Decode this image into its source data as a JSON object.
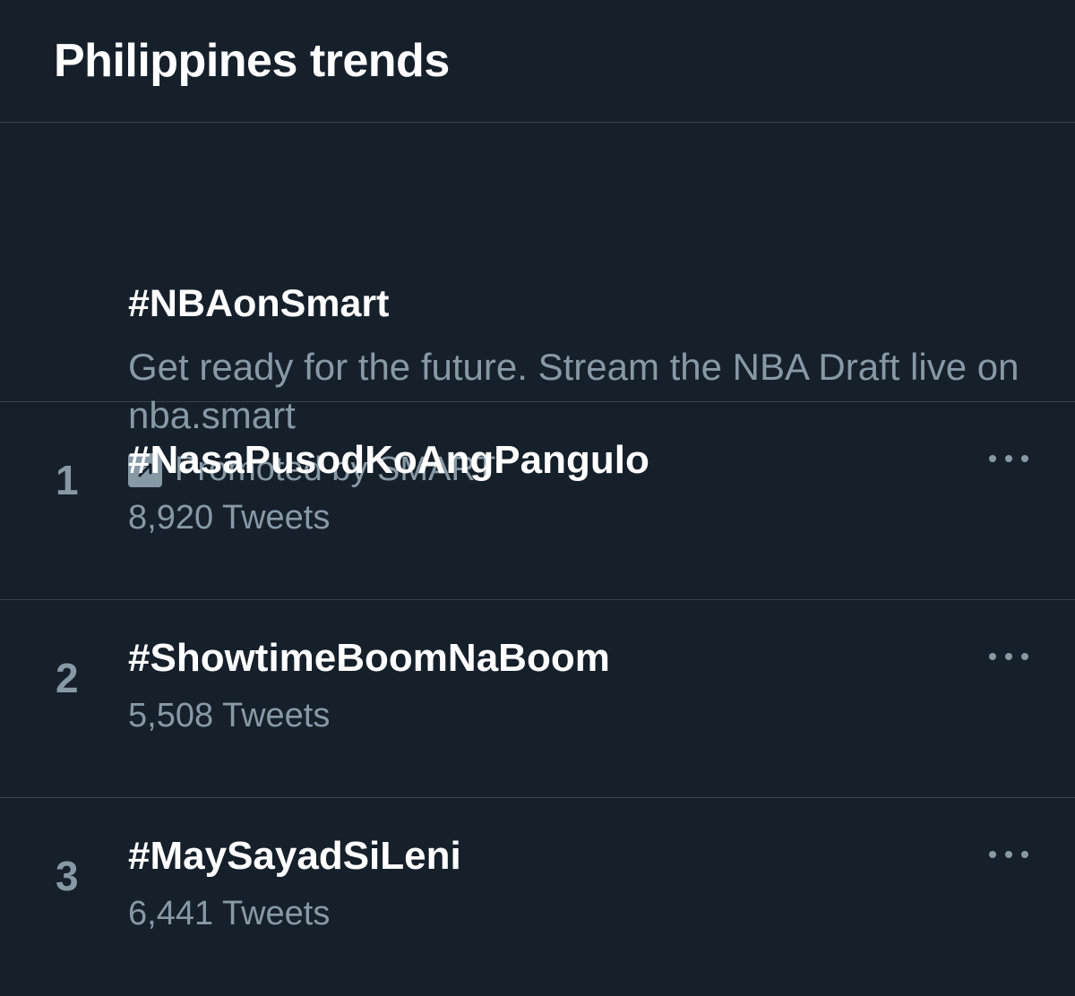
{
  "header": {
    "title": "Philippines trends"
  },
  "promoted": {
    "hashtag": "#NBAonSmart",
    "description": "Get ready for the future. Stream the NBA Draft live on nba.smart",
    "promoted_by": "Promoted by SMART",
    "icon": "promoted-arrow-icon"
  },
  "trends": [
    {
      "rank": "1",
      "hashtag": "#NasaPusodKoAngPangulo",
      "count": "8,920 Tweets"
    },
    {
      "rank": "2",
      "hashtag": "#ShowtimeBoomNaBoom",
      "count": "5,508 Tweets"
    },
    {
      "rank": "3",
      "hashtag": "#MaySayadSiLeni",
      "count": "6,441 Tweets"
    }
  ],
  "colors": {
    "background": "#15202b",
    "divider": "#38444d",
    "secondary_text": "#8899a6",
    "primary_text": "#ffffff"
  }
}
